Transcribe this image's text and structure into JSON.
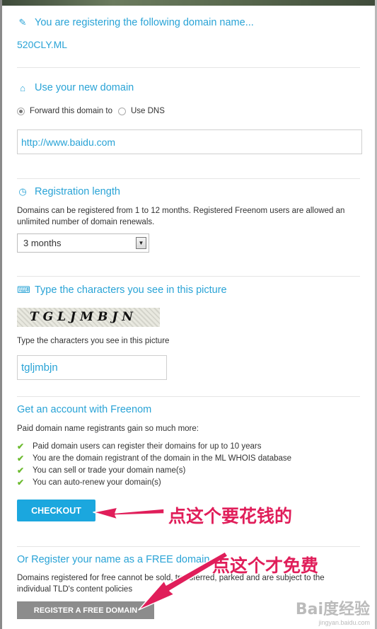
{
  "section_domain": {
    "heading": "You are registering the following domain name...",
    "domain": "520CLY.ML"
  },
  "section_use": {
    "heading": "Use your new domain",
    "option_forward": "Forward this domain to",
    "option_dns": "Use DNS",
    "url_value": "http://www.baidu.com"
  },
  "section_length": {
    "heading": "Registration length",
    "description": "Domains can be registered from 1 to 12 months. Registered Freenom users are allowed an unlimited number of domain renewals.",
    "selected": "3 months"
  },
  "section_captcha": {
    "heading": "Type the characters you see in this picture",
    "captcha_text": "TGLJMBJN",
    "label": "Type the characters you see in this picture",
    "input_value": "tgljmbjn"
  },
  "section_account": {
    "heading": "Get an account with Freenom",
    "intro": "Paid domain name registrants gain so much more:",
    "benefits": [
      "Paid domain users can register their domains for up to 10 years",
      "You are the domain registrant of the domain in the ML WHOIS database",
      "You can sell or trade your domain name(s)",
      "You can auto-renew your domain(s)"
    ],
    "checkout_label": "CHECKOUT"
  },
  "section_free": {
    "heading": "Or Register your name as a FREE domain",
    "description": "Domains registered for free cannot be sold, transferred, parked and are subject to the individual TLD's content policies",
    "button_label": "REGISTER A FREE DOMAIN"
  },
  "annotations": {
    "checkout_note": "点这个要花钱的",
    "free_note": "点这个才免费",
    "color": "#e01e5a"
  },
  "watermark": {
    "main": "Bai度经验",
    "sub": "jingyan.baidu.com"
  },
  "colors": {
    "accent": "#29a3d6",
    "checkout_bg": "#1ba7de",
    "free_button_bg": "#8c8c8c",
    "check": "#6cbb2f"
  },
  "icons": [
    "pencil-icon",
    "home-icon",
    "clock-icon",
    "keyboard-icon",
    "check-icon"
  ]
}
